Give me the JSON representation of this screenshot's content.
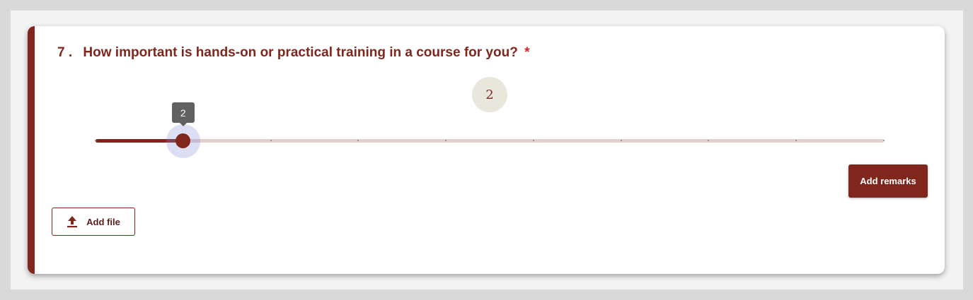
{
  "question": {
    "number": "7 .",
    "text": "How important is hands-on or practical training in a course for you?",
    "required_mark": "*"
  },
  "slider": {
    "min": 1,
    "max": 10,
    "value": 2,
    "value_display": "2",
    "tooltip": "2"
  },
  "actions": {
    "remarks_label": "Add remarks",
    "file_label": "Add file",
    "file_icon": "upload-icon"
  },
  "colors": {
    "accent": "#80261d",
    "track": "#e4cfcf",
    "required": "#d8262b",
    "value_bubble": "#e9e7dc",
    "tooltip": "#616161",
    "thumb_halo": "#808cd8"
  }
}
